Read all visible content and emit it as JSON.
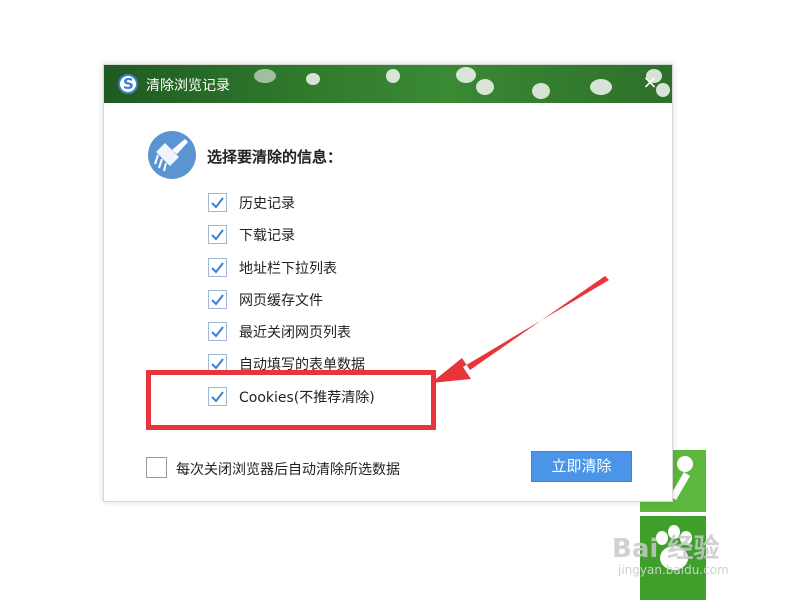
{
  "dialog": {
    "title": "清除浏览记录",
    "close_glyph": "×",
    "section_title": "选择要清除的信息：",
    "options": [
      {
        "label": "历史记录",
        "checked": true
      },
      {
        "label": "下载记录",
        "checked": true
      },
      {
        "label": "地址栏下拉列表",
        "checked": true
      },
      {
        "label": "网页缓存文件",
        "checked": true
      },
      {
        "label": "最近关闭网页列表",
        "checked": true
      },
      {
        "label": "自动填写的表单数据",
        "checked": true
      },
      {
        "label": "Cookies(不推荐清除)",
        "checked": true
      }
    ],
    "auto_clear_label": "每次关闭浏览器后自动清除所选数据",
    "auto_clear_checked": false,
    "clear_button_label": "立即清除"
  },
  "icons": {
    "browser": "browser-logo-icon",
    "broom": "broom-icon",
    "check": "checkmark-icon"
  },
  "colors": {
    "annotation_red": "#e8343b",
    "button_blue": "#4b95e8",
    "check_blue": "#3f7fd0",
    "side_green": "#5cb83c"
  },
  "watermark": {
    "text": "Bai 经验",
    "sub": "jingyan.baidu.com"
  }
}
